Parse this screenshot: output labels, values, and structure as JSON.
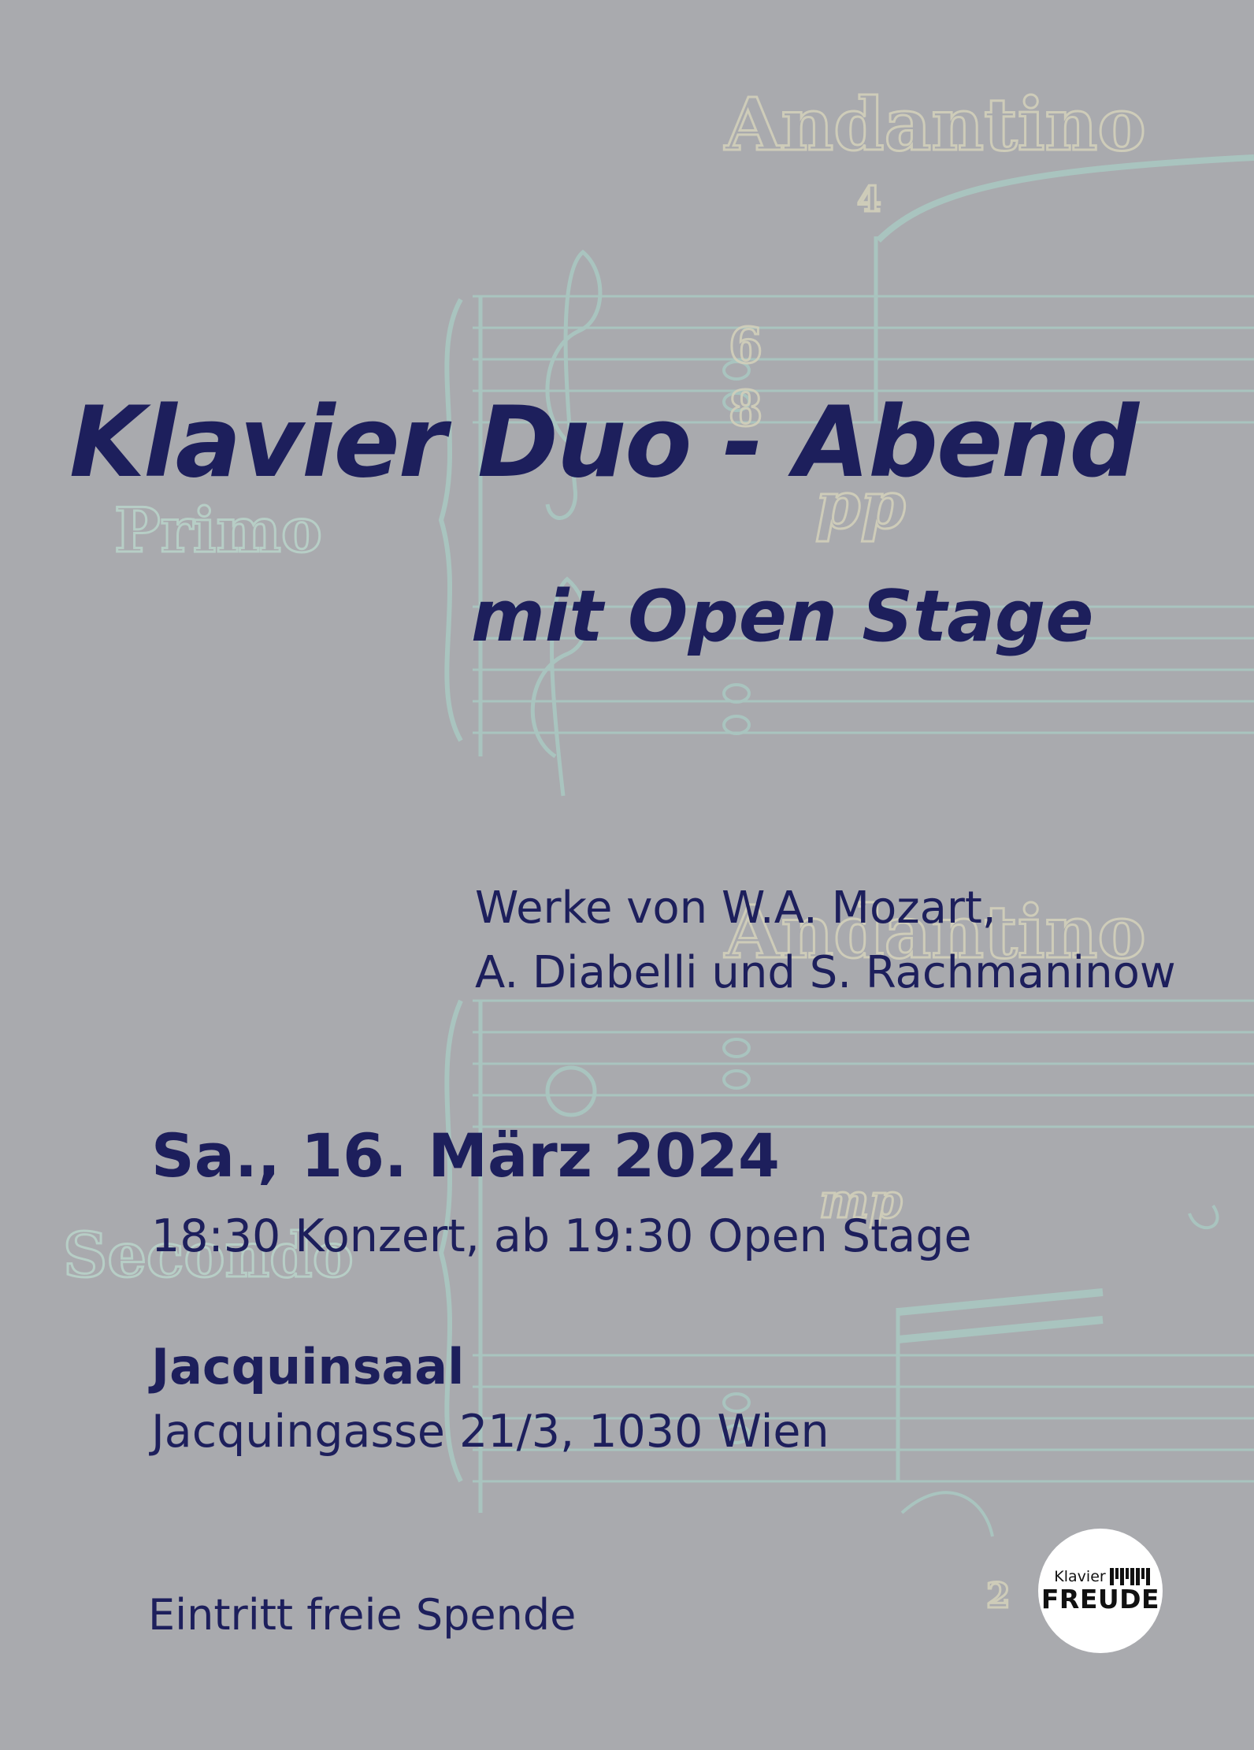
{
  "poster": {
    "title": "Klavier Duo - Abend",
    "subtitle": "mit Open Stage",
    "works": [
      "Werke von W.A. Mozart,",
      "A. Diabelli und S. Rachmaninow"
    ],
    "date": "Sa., 16. März 2024",
    "times": "18:30 Konzert, ab 19:30 Open Stage",
    "venue": "Jacquinsaal",
    "address": "Jacquingasse 21/3, 1030 Wien",
    "entry": "Eintritt freie Spende"
  },
  "background_score": {
    "tempo_top": "Andantino",
    "tempo_bottom": "Andantino",
    "part_primo": "Primo",
    "part_secondo": "Secondo",
    "dynamic_pp": "pp",
    "dynamic_mp": "mp",
    "time_sig_top": "6",
    "time_sig_bottom": "8",
    "fingering_1": "4",
    "fingering_2": "2"
  },
  "logo": {
    "line1": "Klavier",
    "line2": "FREUDE"
  },
  "colors": {
    "background": "#a9aaae",
    "text": "#1d1f5c",
    "score_cyan": "#9fc9c4",
    "score_cream": "#d8d3b8"
  }
}
